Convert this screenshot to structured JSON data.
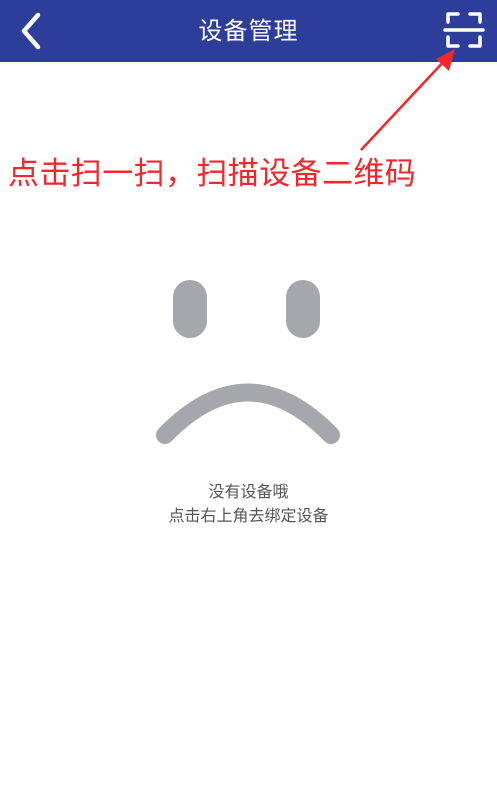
{
  "header": {
    "title": "设备管理",
    "back_icon": "chevron-left-icon",
    "scan_icon": "scan-frame-icon",
    "background": "#2c3e9a"
  },
  "annotation": {
    "text": "点击扫一扫，扫描设备二维码",
    "color": "#f2262b"
  },
  "empty_state": {
    "icon": "sad-face-icon",
    "icon_color": "#a6a6ad",
    "line1": "没有设备哦",
    "line2": "点击右上角去绑定设备"
  }
}
